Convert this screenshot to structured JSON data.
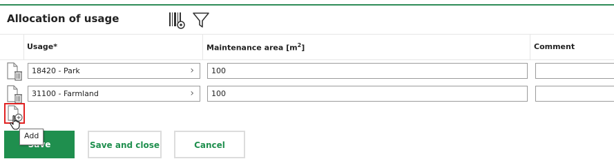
{
  "header": {
    "title": "Allocation of usage",
    "icons": [
      "barcode-settings-icon",
      "filter-icon"
    ]
  },
  "table": {
    "columns": [
      "Usage*",
      "Maintenance area [m",
      "2",
      "]",
      "Comment"
    ],
    "rows": [
      {
        "usage": "18420 - Park",
        "area": "100",
        "comment": ""
      },
      {
        "usage": "31100 - Farmland",
        "area": "100",
        "comment": ""
      }
    ]
  },
  "add": {
    "tooltip": "Add"
  },
  "buttons": {
    "save": "Save",
    "save_close": "Save and close",
    "cancel": "Cancel"
  },
  "colors": {
    "accent": "#1f8f4e",
    "highlight": "#e02020"
  }
}
